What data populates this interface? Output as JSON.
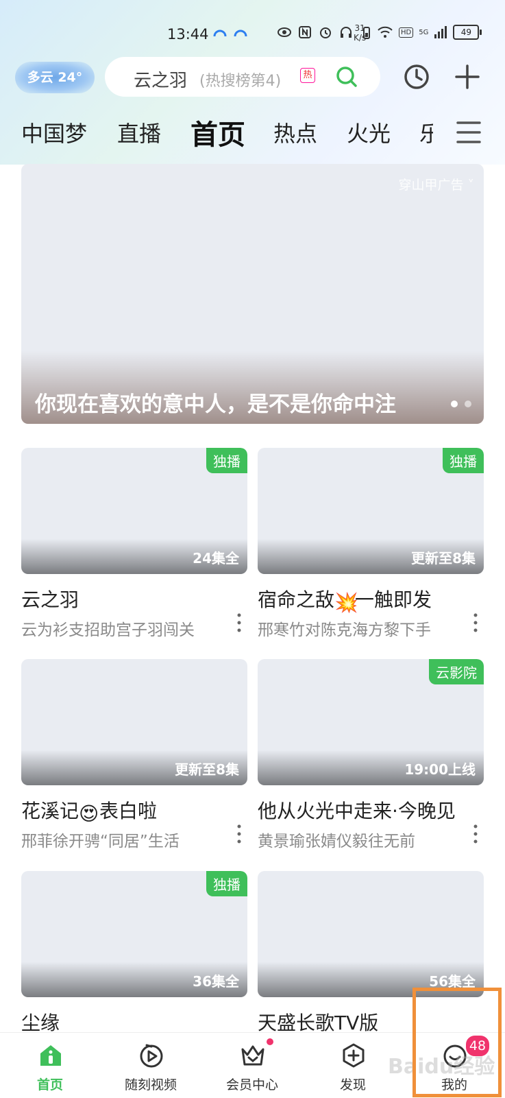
{
  "status_bar": {
    "time": "13:44",
    "net_speed_value": "31",
    "net_speed_unit": "K/s",
    "hd": "HD",
    "network": "5G",
    "battery": "49"
  },
  "header": {
    "weather": "多云 24°",
    "search_query": "云之羽",
    "search_hint": "(热搜榜第4)",
    "hot_tag": "热",
    "icons": [
      "search-icon",
      "history-icon",
      "plus-icon"
    ]
  },
  "tabs": [
    {
      "label": "中国梦",
      "active": false
    },
    {
      "label": "直播",
      "active": false
    },
    {
      "label": "首页",
      "active": true
    },
    {
      "label": "热点",
      "active": false
    },
    {
      "label": "火光",
      "active": false
    },
    {
      "label": "乐",
      "active": false
    }
  ],
  "banner": {
    "ad_label": "穿山甲广告 ˅",
    "title": "你现在喜欢的意中人，是不是你命中注"
  },
  "cards": [
    {
      "badge": "独播",
      "episode": "24集全",
      "title": "云之羽",
      "subtitle": "云为衫支招助宫子羽闯关"
    },
    {
      "badge": "独播",
      "episode": "更新至8集",
      "title": "宿命之敌",
      "title_emoji": "💥",
      "title_suffix": "一触即发",
      "subtitle": "邢寒竹对陈克海方黎下手"
    },
    {
      "badge": "",
      "episode": "更新至8集",
      "title": "花溪记",
      "title_emoji": "😍",
      "title_suffix": "表白啦",
      "subtitle": "邢菲徐开骋“同居”生活"
    },
    {
      "badge": "云影院",
      "episode": "19:00上线",
      "title": "他从火光中走来·今晚见",
      "subtitle": "黄景瑜张婧仪毅往无前"
    },
    {
      "badge": "独播",
      "episode": "36集全",
      "title": "尘缘",
      "subtitle": ""
    },
    {
      "badge": "",
      "episode": "56集全",
      "title": "天盛长歌TV版",
      "subtitle": ""
    }
  ],
  "bottom_nav": [
    {
      "label": "首页",
      "icon": "home-icon",
      "active": true
    },
    {
      "label": "随刻视频",
      "icon": "play-circle-icon",
      "active": false
    },
    {
      "label": "会员中心",
      "icon": "crown-icon",
      "active": false
    },
    {
      "label": "发现",
      "icon": "discover-plus-icon",
      "active": false
    },
    {
      "label": "我的",
      "icon": "profile-smile-icon",
      "active": false,
      "badge": "48"
    }
  ],
  "colors": {
    "accent_green": "#3fbf5a",
    "badge_red": "#f0336c",
    "highlight_orange": "#f0903a"
  },
  "watermark": "Baidu经验"
}
